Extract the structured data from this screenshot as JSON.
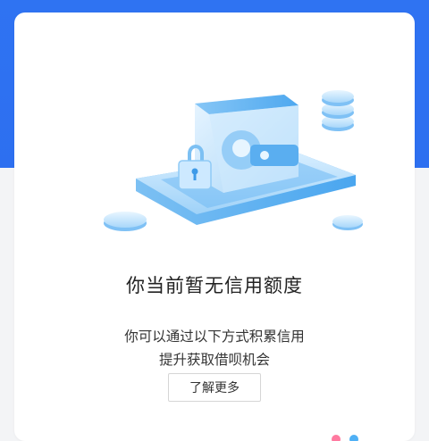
{
  "header": {
    "accent_color": "#2f73f2"
  },
  "empty_state": {
    "illustration": "wallet-with-lock-and-coins-icon",
    "title": "你当前暂无信用额度",
    "description_lines": [
      "你可以通过以下方式积累信用",
      "提升获取借呗机会"
    ],
    "learn_more_label": "了解更多"
  }
}
